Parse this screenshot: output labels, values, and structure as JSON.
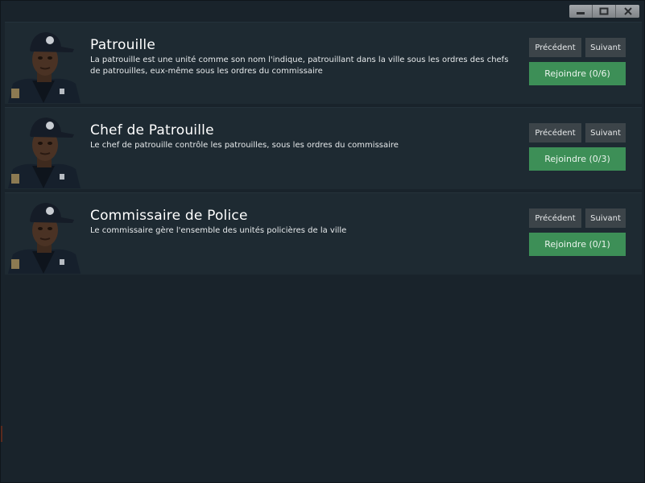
{
  "window": {
    "controls": [
      {
        "name": "minimize-icon"
      },
      {
        "name": "maximize-icon"
      },
      {
        "name": "close-icon"
      }
    ]
  },
  "jobs": [
    {
      "title": "Patrouille",
      "description": "La patrouille est une unité comme son nom l'indique, patrouillant dans la ville sous les ordres des chefs de patrouilles, eux-même sous les ordres du commissaire",
      "prev_label": "Précédent",
      "next_label": "Suivant",
      "join_label": "Rejoindre (0/6)"
    },
    {
      "title": "Chef de Patrouille",
      "description": "Le chef de patrouille contrôle les patrouilles, sous les ordres du commissaire",
      "prev_label": "Précédent",
      "next_label": "Suivant",
      "join_label": "Rejoindre (0/3)"
    },
    {
      "title": "Commissaire de Police",
      "description": "Le commissaire gère l'ensemble des unités policières de la  ville",
      "prev_label": "Précédent",
      "next_label": "Suivant",
      "join_label": "Rejoindre (0/1)"
    }
  ],
  "colors": {
    "background": "#19232b",
    "card": "#1e2a32",
    "button": "#3c4449",
    "join_button": "#3d8f57"
  }
}
